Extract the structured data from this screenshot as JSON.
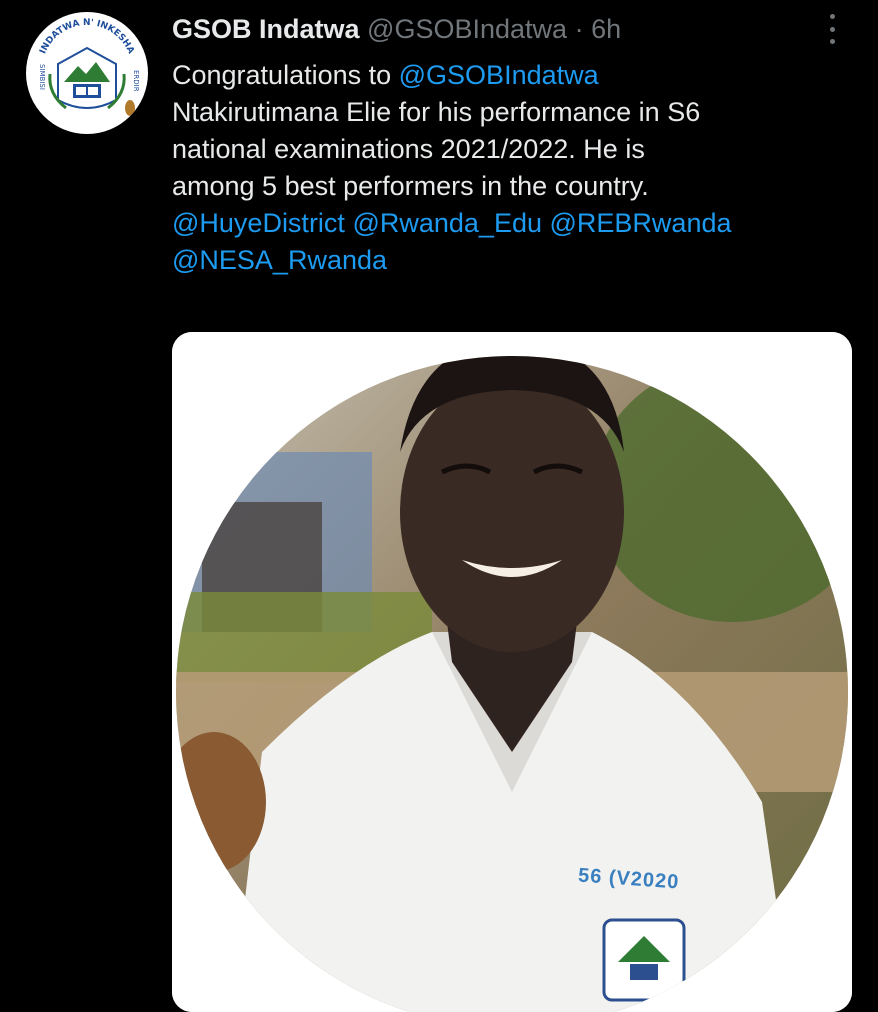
{
  "tweet": {
    "author_name": "GSOB Indatwa",
    "handle": "@GSOBIndatwa",
    "separator": "·",
    "time": "6h",
    "lines": [
      [
        {
          "t": "Congratulations to ",
          "m": false
        },
        {
          "t": "@GSOBIndatwa",
          "m": true
        }
      ],
      [
        {
          "t": "Ntakirutimana Elie for his performance in S6",
          "m": false
        }
      ],
      [
        {
          "t": "national examinations 2021/2022. He is",
          "m": false
        }
      ],
      [
        {
          "t": "among 5 best performers in the country.",
          "m": false
        }
      ],
      [
        {
          "t": "@HuyeDistrict",
          "m": true
        },
        {
          "t": " ",
          "m": false
        },
        {
          "t": "@Rwanda_Edu",
          "m": true
        },
        {
          "t": " ",
          "m": false
        },
        {
          "t": "@REBRwanda",
          "m": true
        }
      ],
      [
        {
          "t": "@NESA_Rwanda",
          "m": true
        }
      ]
    ]
  },
  "avatar": {
    "logo_top_text": "INDATWA N' INKESHA",
    "logo_left_text": "SIMBISI",
    "logo_right_text": "ERDIR"
  },
  "media": {
    "shirt_label": "56 (V2020",
    "ring_color": "#d99a2b",
    "accent_color": "#1d9bf0"
  }
}
